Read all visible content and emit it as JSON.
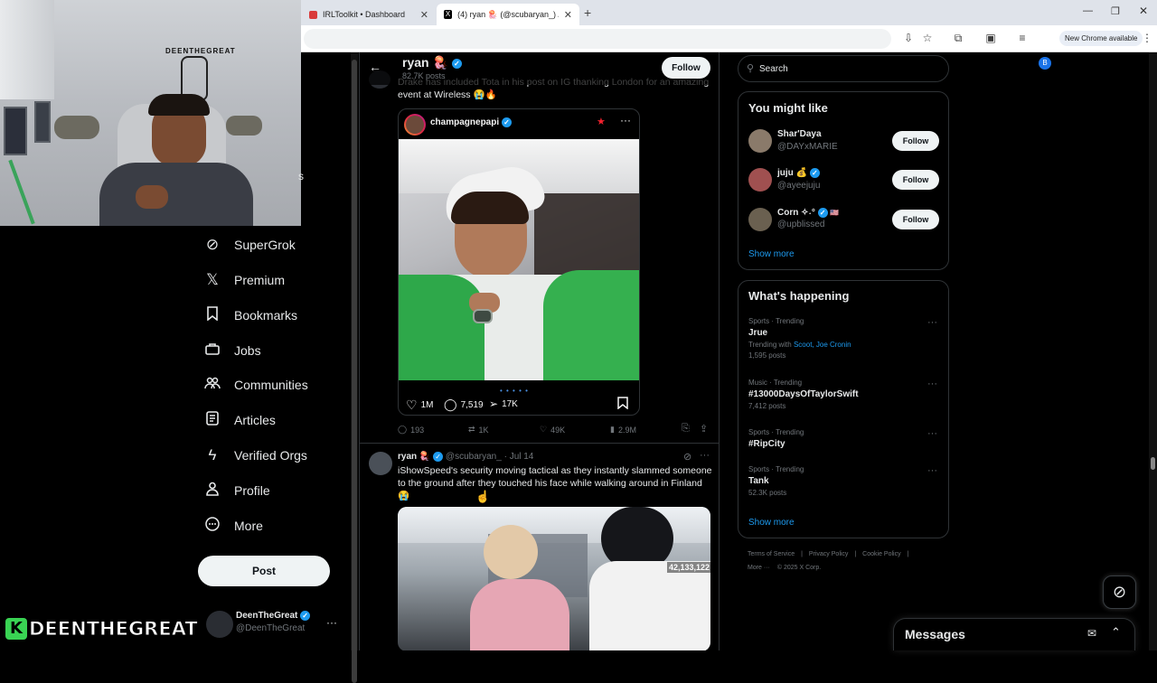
{
  "browser": {
    "tabs": [
      {
        "title": "IRLToolkit • Dashboard"
      },
      {
        "title": "(4) ryan 🪼 (@scubaryan_) / X"
      }
    ],
    "new_chrome_label": "New Chrome available",
    "profile_initial": "B"
  },
  "nav": {
    "items": [
      {
        "label": "SuperGrok",
        "icon": "grok-icon"
      },
      {
        "label": "Premium",
        "icon": "x-logo-icon"
      },
      {
        "label": "Bookmarks",
        "icon": "bookmark-icon"
      },
      {
        "label": "Jobs",
        "icon": "briefcase-icon"
      },
      {
        "label": "Communities",
        "icon": "people-icon"
      },
      {
        "label": "Articles",
        "icon": "article-icon"
      },
      {
        "label": "Verified Orgs",
        "icon": "lightning-icon"
      },
      {
        "label": "Profile",
        "icon": "person-icon"
      },
      {
        "label": "More",
        "icon": "more-circle-icon"
      }
    ],
    "post_label": "Post",
    "account_name": "DeenTheGreat",
    "account_handle": "@DeenTheGreat"
  },
  "webcam": {
    "banner_text": "DEENTHEGREAT",
    "wall_sign": "DEENTHEGREAT",
    "overlay_letter": "K"
  },
  "profile_header": {
    "name": "ryan 🪼",
    "posts_count": "82.7K posts",
    "follow_label": "Follow"
  },
  "tweet1": {
    "text": "Drake has included Tota in his post on IG thanking London for an amazing event at Wireless 😭🔥",
    "ig": {
      "username": "champagnepapi",
      "likes": "1M",
      "comments": "7,519",
      "shares": "17K"
    },
    "replies": "193",
    "retweets": "1K",
    "likes": "49K",
    "views": "2.9M"
  },
  "tweet2": {
    "name": "ryan 🪼",
    "handle": "@scubaryan_",
    "date": "Jul 14",
    "text": "iShowSpeed's security moving tactical as they instantly slammed someone to the ground after they touched his face while walking around in Finland 😭",
    "video_counter": "42,133,122"
  },
  "sidebar": {
    "search_placeholder": "Search",
    "might_like_title": "You might like",
    "suggestions": [
      {
        "name": "Shar'Daya",
        "handle": "@DAYxMARIE",
        "follow": "Follow"
      },
      {
        "name": "juju 💰",
        "handle": "@ayeejuju",
        "follow": "Follow"
      },
      {
        "name": "Corn ✧˖°",
        "handle": "@upblissed",
        "follow": "Follow"
      }
    ],
    "show_more": "Show more",
    "happening_title": "What's happening",
    "trends": [
      {
        "meta": "Sports · Trending",
        "title": "Jrue",
        "extra_prefix": "Trending with",
        "extra_links": "Scoot, Joe Cronin",
        "posts": "1,595 posts"
      },
      {
        "meta": "Music · Trending",
        "title": "#13000DaysOfTaylorSwift",
        "posts": "7,412 posts"
      },
      {
        "meta": "Sports · Trending",
        "title": "#RipCity",
        "posts": ""
      },
      {
        "meta": "Sports · Trending",
        "title": "Tank",
        "posts": "52.3K posts"
      }
    ],
    "show_more_2": "Show more",
    "footer": {
      "links": [
        "Terms of Service",
        "Privacy Policy",
        "Cookie Policy"
      ],
      "more": "More ···",
      "copyright": "© 2025 X Corp."
    }
  },
  "messages": {
    "title": "Messages"
  },
  "colors": {
    "accent": "#1d9bf0",
    "background": "#000000",
    "border": "#2f3336",
    "like_star": "#f4212e"
  }
}
